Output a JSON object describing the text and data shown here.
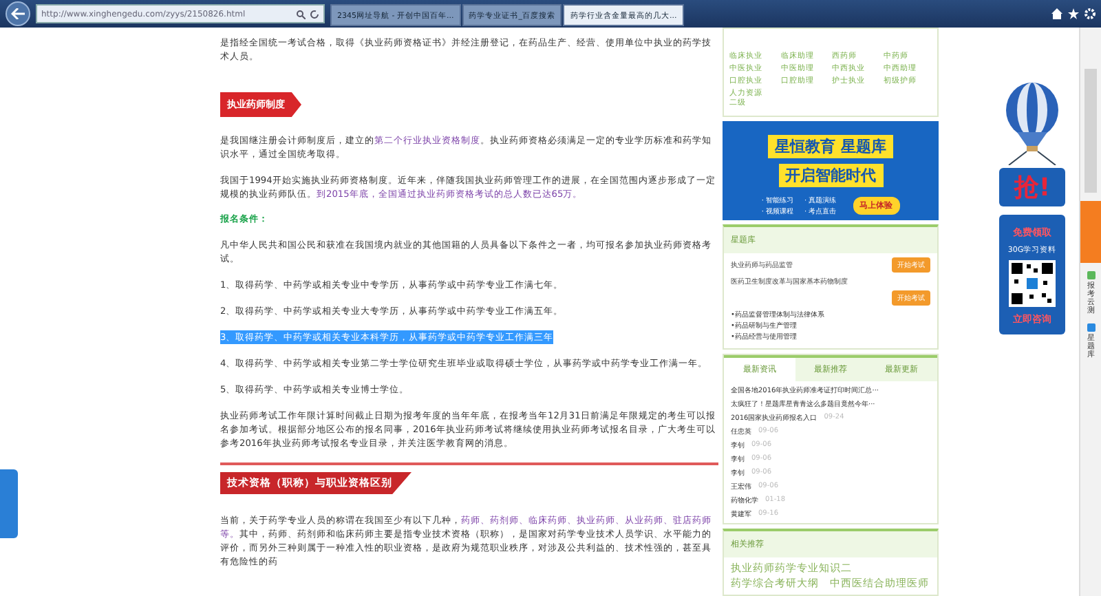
{
  "browser": {
    "address": "http://www.xinghengedu.com/zyys/2150826.html",
    "tabs": [
      {
        "label": "2345网址导航 - 开创中国百年...",
        "selected": false
      },
      {
        "label": "药学专业证书_百度搜索",
        "selected": false
      },
      {
        "label": "药学行业含金量最高的几大...",
        "selected": true
      }
    ]
  },
  "article": {
    "blocks": [
      {
        "kind": "paragraph",
        "segments": [
          {
            "text": "是指经全国统一考试合格，取得《执业药师资格证书》并经注册登记，在药品生产、经营、使用单位中执业的药学技术人员。",
            "link": false
          }
        ]
      },
      {
        "kind": "tag_heading",
        "text": "执业药师制度"
      },
      {
        "kind": "paragraph",
        "segments": [
          {
            "text": "是我国继注册会计师制度后，建立的",
            "link": false
          },
          {
            "text": "第二个行业执业资格制度",
            "link": true
          },
          {
            "text": "。执业药师资格必须满足一定的专业学历标准和药学知识水平，通过全国统考取得。",
            "link": false
          }
        ]
      },
      {
        "kind": "paragraph",
        "segments": [
          {
            "text": "我国于1994开始实施执业药师资格制度。近年来，伴随我国执业药师管理工作的进展，在全国范围内逐步形成了一定规模的执业药师队伍。",
            "link": false
          },
          {
            "text": "到2015年底，全国通过执业药师资格考试的总人数已达65万。",
            "link": true
          }
        ]
      },
      {
        "kind": "green_heading",
        "text": "报名条件："
      },
      {
        "kind": "paragraph",
        "segments": [
          {
            "text": "凡中华人民共和国公民和获准在我国境内就业的其他国籍的人员具备以下条件之一者，均可报名参加执业药师资格考试。",
            "link": false
          }
        ]
      },
      {
        "kind": "list_item",
        "text": "1、取得药学、中药学或相关专业中专学历，从事药学或中药学专业工作满七年。",
        "selected": false
      },
      {
        "kind": "list_item",
        "text": "2、取得药学、中药学或相关专业大专学历，从事药学或中药学专业工作满五年。",
        "selected": false
      },
      {
        "kind": "list_item",
        "text": "3、取得药学、中药学或相关专业本科学历，从事药学或中药学专业工作满三年",
        "selected": true
      },
      {
        "kind": "list_item",
        "text": "4、取得药学、中药学或相关专业第二学士学位研究生班毕业或取得硕士学位，从事药学或中药学专业工作满一年。",
        "selected": false
      },
      {
        "kind": "list_item",
        "text": "5、取得药学、中药学或相关专业博士学位。",
        "selected": false
      },
      {
        "kind": "paragraph",
        "segments": [
          {
            "text": "执业药师考试工作年限计算时间截止日期为报考年度的当年年底，在报考当年12月31日前满足年限规定的考生可以报名参加考试。根据部分地区公布的报名同事，2016年执业药师考试将继续使用执业药师考试报名目录，广大考生可以参考2016年执业药师考试报名专业目录，并关注医学教育网的消息。",
            "link": false
          }
        ]
      },
      {
        "kind": "section_heading",
        "text": "技术资格（职称）与职业资格区别"
      },
      {
        "kind": "paragraph",
        "segments": [
          {
            "text": "当前，关于药学专业人员的称谓在我国至少有以下几种，",
            "link": false
          },
          {
            "text": "药师、药剂师、临床药师、执业药师、从业药师、驻店药师等。",
            "link": true
          },
          {
            "text": "其中，药师、药剂师和临床药师主要是指专业技术资格（职称），是国家对药学专业技术人员学识、水平能力的评价，而另外三种则属于一种准入性的职业资格，是政府为规范职业秩序，对涉及公共利益的、技术性强的，甚至具有危险性的药",
            "link": false
          }
        ]
      }
    ]
  },
  "sidebar": {
    "exam_links": [
      "临床执业",
      "临床助理",
      "西药师",
      "中药师",
      "中医执业",
      "中医助理",
      "中西执业",
      "中西助理",
      "口腔执业",
      "口腔助理",
      "护士执业",
      "初级护师",
      "人力资源二级"
    ],
    "banner": {
      "title_1": "星恒教育 星题库",
      "title_2": "开启智能时代",
      "features": [
        "· 智能练习",
        "· 真题演练",
        "· 视频课程",
        "· 考点直击"
      ],
      "button": "马上体验"
    },
    "question_bank": {
      "title": "星题库",
      "exams": [
        {
          "name": "执业药师与药品监管",
          "button": "开始考试"
        },
        {
          "name": "医药卫生制度改革与国家基本药物制度",
          "button": "开始考试"
        }
      ],
      "topics": [
        "•药品监督管理体制与法律体系",
        "•药品研制与生产管理",
        "•药品经营与使用管理"
      ]
    },
    "news": {
      "tabs": [
        {
          "label": "最新资讯",
          "selected": true
        },
        {
          "label": "最新推荐",
          "selected": false
        },
        {
          "label": "最新更新",
          "selected": false
        }
      ],
      "items": [
        {
          "title": "全国各地2016年执业药师准考证打印时间汇总···"
        },
        {
          "title": "太疯狂了！星题库星青青这么多题目竟然今年···"
        },
        {
          "title": "2016国家执业药师报名入口",
          "date": "09-24"
        },
        {
          "title": "任忠英",
          "date": "09-06"
        },
        {
          "title": "李钊",
          "date": "09-06"
        },
        {
          "title": "李钊",
          "date": "09-06"
        },
        {
          "title": "李钊",
          "date": "09-06"
        },
        {
          "title": "王宏伟",
          "date": "09-06"
        },
        {
          "title": "药物化学",
          "date": "01-18"
        },
        {
          "title": "黄建军",
          "date": "09-16"
        }
      ]
    },
    "related": {
      "title": "相关推荐",
      "links": [
        "执业药师药学专业知识二",
        "药学综合考研大纲",
        "中西医结合助理医师"
      ]
    }
  },
  "ad": {
    "sign": "抢!",
    "headline": "免费领取",
    "subtitle": "30G学习资料",
    "cta": "立即咨询"
  },
  "right_rail": {
    "items": [
      "报考云测",
      "星题库"
    ]
  }
}
